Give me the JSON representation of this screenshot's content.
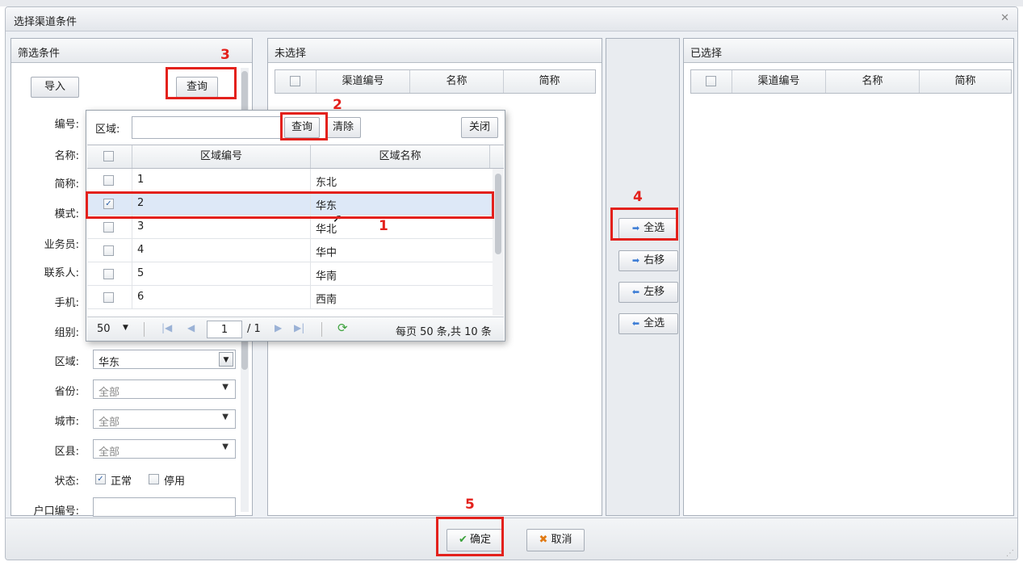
{
  "dialog": {
    "title": "选择渠道条件"
  },
  "filter": {
    "title": "筛选条件",
    "import_label": "导入",
    "query_label": "查询",
    "labels": [
      "编号:",
      "名称:",
      "简称:",
      "模式:",
      "业务员:",
      "联系人:",
      "手机:",
      "组别:",
      "区域:",
      "省份:",
      "城市:",
      "区县:",
      "状态:",
      "户口编号:"
    ],
    "region_value": "华东",
    "province_value": "全部",
    "city_value": "全部",
    "county_value": "全部",
    "status_normal": "正常",
    "status_disabled": "停用"
  },
  "popup": {
    "region_label": "区域:",
    "query_label": "查询",
    "clear_label": "清除",
    "close_label": "关闭",
    "col_code": "区域编号",
    "col_name": "区域名称",
    "rows": [
      {
        "code": "1",
        "name": "东北",
        "checked": false
      },
      {
        "code": "2",
        "name": "华东",
        "checked": true
      },
      {
        "code": "3",
        "name": "华北",
        "checked": false
      },
      {
        "code": "4",
        "name": "华中",
        "checked": false
      },
      {
        "code": "5",
        "name": "华南",
        "checked": false
      },
      {
        "code": "6",
        "name": "西南",
        "checked": false
      }
    ],
    "page_size": "50",
    "page_current": "1",
    "page_total": "/ 1",
    "summary": "每页 50 条,共 10 条"
  },
  "unselected": {
    "title": "未选择",
    "col_code": "渠道编号",
    "col_name": "名称",
    "col_short": "简称"
  },
  "selected": {
    "title": "已选择",
    "col_code": "渠道编号",
    "col_name": "名称",
    "col_short": "简称"
  },
  "middle": {
    "select_all_right": "全选",
    "move_right": "右移",
    "move_left": "左移",
    "select_all_left": "全选"
  },
  "footer": {
    "ok_label": "确定",
    "cancel_label": "取消"
  },
  "annotations": [
    "1",
    "2",
    "3",
    "4",
    "5"
  ],
  "colors": {
    "highlight": "#e3211c",
    "selected_row": "#dde8f7"
  }
}
